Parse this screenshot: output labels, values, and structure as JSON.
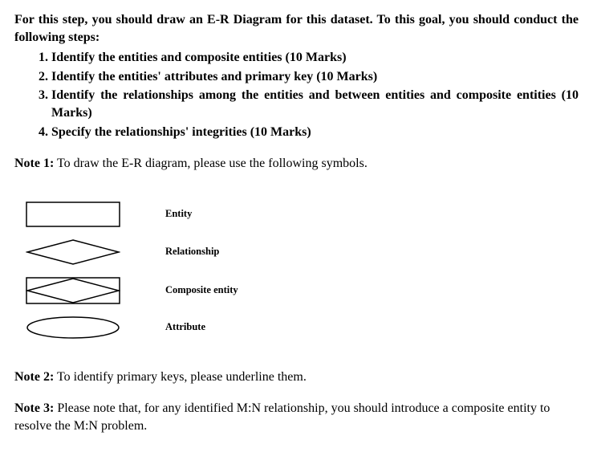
{
  "intro": "For this step, you should draw an E-R Diagram for this dataset.  To this goal, you should conduct the following steps:",
  "steps": [
    "Identify the entities and composite entities (10 Marks)",
    "Identify the entities' attributes and primary key (10 Marks)",
    "Identify the relationships among the entities and between entities and composite entities (10 Marks)",
    "Specify the relationships' integrities (10 Marks)"
  ],
  "notes": {
    "n1_label": "Note 1:",
    "n1_text": " To draw the E-R diagram, please use the following symbols.",
    "n2_label": "Note 2:",
    "n2_text": " To identify primary keys, please underline them.",
    "n3_label": "Note 3:",
    "n3_text": " Please note that, for any identified M:N relationship, you should introduce a composite entity to resolve the M:N problem."
  },
  "legend": {
    "entity": "Entity",
    "relationship": "Relationship",
    "composite": "Composite entity",
    "attribute": "Attribute"
  }
}
